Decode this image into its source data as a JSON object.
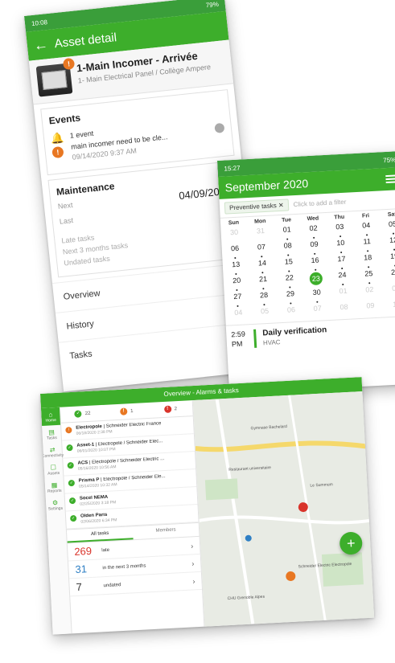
{
  "phone1": {
    "status_time": "10:08",
    "status_battery": "79%",
    "title": "Asset detail",
    "asset_name": "1-Main Incomer - Arrivée",
    "asset_location": "1- Main Electrical Panel / Collège Ampere",
    "events_heading": "Events",
    "event_count": "1 event",
    "event_text": "main incomer need to be cle...",
    "event_date": "09/14/2020 9:37 AM",
    "maintenance_heading": "Maintenance",
    "next_label": "Next",
    "last_label": "Last",
    "next_date": "04/09/2019",
    "late_tasks": "Late tasks",
    "next3": "Next 3 months tasks",
    "undated": "Undated tasks",
    "nav": [
      "Overview",
      "History",
      "Tasks"
    ]
  },
  "phone2": {
    "status_time": "15:27",
    "status_battery": "75%",
    "month": "September 2020",
    "filter_chip": "Preventive tasks",
    "filter_placeholder": "Click to add a filter",
    "weekdays": [
      "Sun",
      "Mon",
      "Tue",
      "Wed",
      "Thu",
      "Fri",
      "Sat"
    ],
    "weeks": [
      [
        "30",
        "31",
        "01",
        "02",
        "03",
        "04",
        "05"
      ],
      [
        "06",
        "07",
        "08",
        "09",
        "10",
        "11",
        "12"
      ],
      [
        "13",
        "14",
        "15",
        "16",
        "17",
        "18",
        "19"
      ],
      [
        "20",
        "21",
        "22",
        "23",
        "24",
        "25",
        "26"
      ],
      [
        "27",
        "28",
        "29",
        "30",
        "01",
        "02",
        "03"
      ],
      [
        "04",
        "05",
        "06",
        "07",
        "08",
        "09",
        "10"
      ]
    ],
    "today": "23",
    "task_time": "2:59 PM",
    "task_name": "Daily verification",
    "task_category": "HVAC"
  },
  "tablet": {
    "title": "Overview - Alarms & tasks",
    "rail": [
      "Home",
      "Tasks",
      "Connectivity",
      "Assets",
      "Reports",
      "Settings"
    ],
    "counters": [
      "22",
      "1",
      "2"
    ],
    "alarms": [
      {
        "name": "Electropole",
        "loc": "Schneider Electric France",
        "date": "06/18/2020 2:38 PM",
        "warn": true
      },
      {
        "name": "Asset-1",
        "loc": "Electropole / Schneider Elec...",
        "date": "06/01/2020 10:07 PM",
        "warn": false
      },
      {
        "name": "ACS",
        "loc": "Electropole / Schneider Electric ...",
        "date": "05/16/2020 10:56 AM",
        "warn": false
      },
      {
        "name": "Prisma P",
        "loc": "Electropole / Schneider Ele...",
        "date": "05/14/2020 10:32 AM",
        "warn": false
      },
      {
        "name": "Socel NEMA",
        "loc": "",
        "date": "02/25/2020 3:18 PM",
        "warn": false
      },
      {
        "name": "Olden Paris",
        "loc": "",
        "date": "02/06/2020 6:34 PM",
        "warn": false
      }
    ],
    "tabs": [
      "All tasks",
      "Members"
    ],
    "stats": [
      {
        "n": "269",
        "label": "late",
        "color": "#d9342b"
      },
      {
        "n": "31",
        "label": "in the next 3 months",
        "color": "#2e7fc4"
      },
      {
        "n": "7",
        "label": "undated",
        "color": "#333333"
      }
    ],
    "map_labels": [
      "Gymnase Bachelard",
      "Restaurant universitaire",
      "Le Summum",
      "CHU Grenoble Alpes",
      "Schneider Electric Electropole"
    ]
  }
}
